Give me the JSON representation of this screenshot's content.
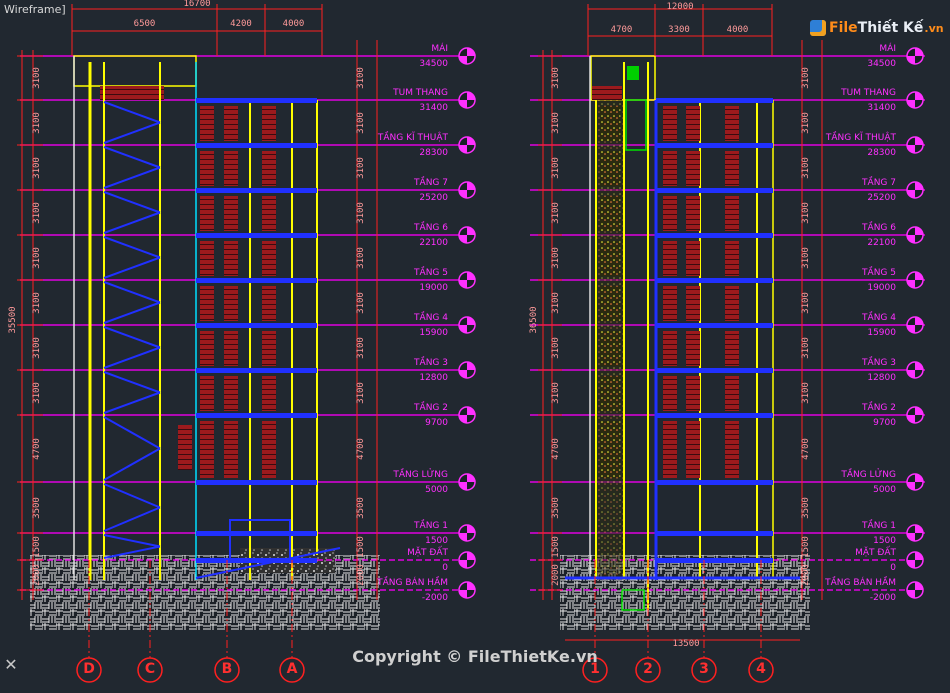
{
  "viewport": {
    "label": "Wireframe]"
  },
  "watermark": {
    "logo_part1": "File",
    "logo_part2": "Thiết Kế",
    "logo_part3": ".vn",
    "copyright": "Copyright © FileThietKe.vn"
  },
  "colors": {
    "background": "#212830",
    "level_line": "#e000e0",
    "dim_red": "#ff2020",
    "wall_yellow": "#ffff00",
    "blue": "#2030ff",
    "cyan": "#00e0ff",
    "text_magenta": "#ff30ff"
  },
  "icons": {
    "close": "close-icon",
    "level_marker": "level-marker-icon",
    "grid_bubble": "grid-bubble-icon"
  },
  "left_section": {
    "overall_width": "16700",
    "top_dims": [
      "6500",
      "4200",
      "4000"
    ],
    "overall_height": "35500",
    "floor_dims": [
      "3100",
      "3100",
      "3100",
      "3100",
      "3100",
      "3100",
      "3100",
      "3100",
      "4700",
      "3500",
      "1500",
      "2000"
    ],
    "grid_labels": [
      "D",
      "C",
      "B",
      "A"
    ]
  },
  "right_section": {
    "overall_width": "12000",
    "top_dims": [
      "4700",
      "3300",
      "4000"
    ],
    "overall_height": "36500",
    "floor_dims": [
      "3100",
      "3100",
      "3100",
      "3100",
      "3100",
      "3100",
      "3100",
      "3100",
      "4700",
      "3500",
      "1500",
      "2000"
    ],
    "bottom_dim": "13500",
    "grid_labels": [
      "1",
      "2",
      "3",
      "4"
    ]
  },
  "levels": [
    {
      "name": "MÁI",
      "elev": "34500"
    },
    {
      "name": "TUM THANG",
      "elev": "31400"
    },
    {
      "name": "TẦNG KĨ THUẬT",
      "elev": "28300"
    },
    {
      "name": "TẦNG 7",
      "elev": "25200"
    },
    {
      "name": "TẦNG 6",
      "elev": "22100"
    },
    {
      "name": "TẦNG 5",
      "elev": "19000"
    },
    {
      "name": "TẦNG 4",
      "elev": "15900"
    },
    {
      "name": "TẦNG 3",
      "elev": "12800"
    },
    {
      "name": "TẦNG 2",
      "elev": "9700"
    },
    {
      "name": "TẦNG LỬNG",
      "elev": "5000"
    },
    {
      "name": "TẦNG 1",
      "elev": "1500"
    },
    {
      "name": "MẶT ĐẤT",
      "elev": "0"
    },
    {
      "name": "TẦNG BÁN HẦM",
      "elev": "-2000"
    }
  ]
}
